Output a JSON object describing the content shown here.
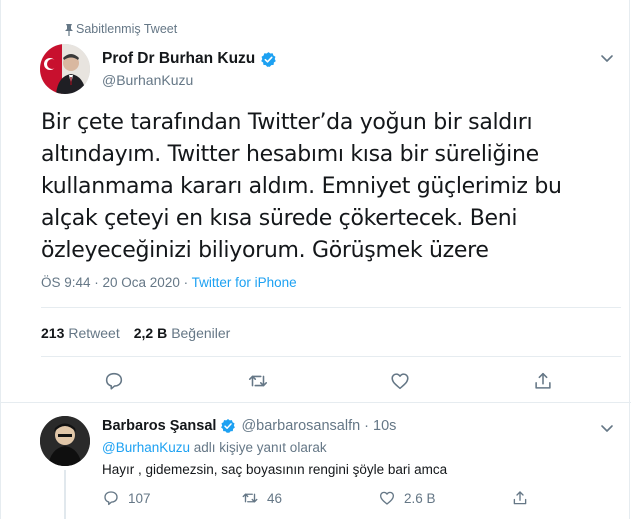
{
  "pinned": {
    "label": "Sabitlenmiş Tweet"
  },
  "tweet": {
    "author_name": "Prof Dr Burhan Kuzu",
    "author_handle": "@BurhanKuzu",
    "text": "Bir çete tarafından Twitter’da yoğun bir saldırı altındayım. Twitter hesabımı kısa bir süreliğine kullanmama kararı aldım. Emniyet güçlerimiz bu alçak çeteyi en kısa sürede çökertecek. Beni özleyeceğinizi biliyorum. Görüşmek üzere",
    "time_date": "ÖS 9:44 · 20 Oca 2020 ·",
    "source": "Twitter for iPhone",
    "retweet_count": "213",
    "retweet_label": "Retweet",
    "like_count": "2,2 B",
    "like_label": "Beğeniler"
  },
  "reply": {
    "author_name": "Barbaros Şansal",
    "author_handle": "@barbarosansalfn · 10s",
    "reply_to_mention": "@BurhanKuzu",
    "reply_to_suffix": " adlı kişiye yanıt olarak",
    "text": "Hayır , gidemezsin, saç boyasının rengini şöyle bari amca",
    "reply_count": "107",
    "retweet_count": "46",
    "like_count": "2.6 B"
  },
  "colors": {
    "accent": "#1da1f2",
    "muted": "#657786",
    "text": "#14171a",
    "border": "#e6ecf0"
  },
  "icons": {
    "pin": "pin-icon",
    "verified": "verified-badge-icon",
    "caret": "chevron-down-icon",
    "reply": "reply-icon",
    "retweet": "retweet-icon",
    "like": "heart-icon",
    "share": "share-icon"
  }
}
